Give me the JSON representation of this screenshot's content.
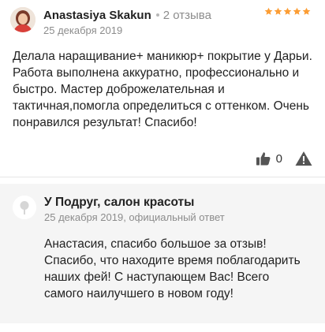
{
  "review": {
    "author_name": "Anastasiya Skakun",
    "review_count": "2 отзыва",
    "rating": 5,
    "star_color": "#fc9d34",
    "date": "25 декабря 2019",
    "text": "Делала наращивание+ маникюр+ покрытие у Дарьи. Работа выполнена аккуратно, профессионально и быстро. Мастер доброжелательная и тактичная,помогла определиться с оттенком. Очень понравился результат! Спасибо!",
    "likes": "0",
    "icons": {
      "like": "thumbs-up-icon",
      "report": "warning-triangle-icon"
    }
  },
  "reply": {
    "business_name": "У Подруг, салон красоты",
    "meta": "25 декабря 2019, официальный ответ",
    "text": "Анастасия, спасибо большое за отзыв! Спасибо, что находите время поблагодарить наших фей! С наступающем Вас! Всего самого наилучшего в новом году!",
    "background": "#f5f5f5"
  }
}
